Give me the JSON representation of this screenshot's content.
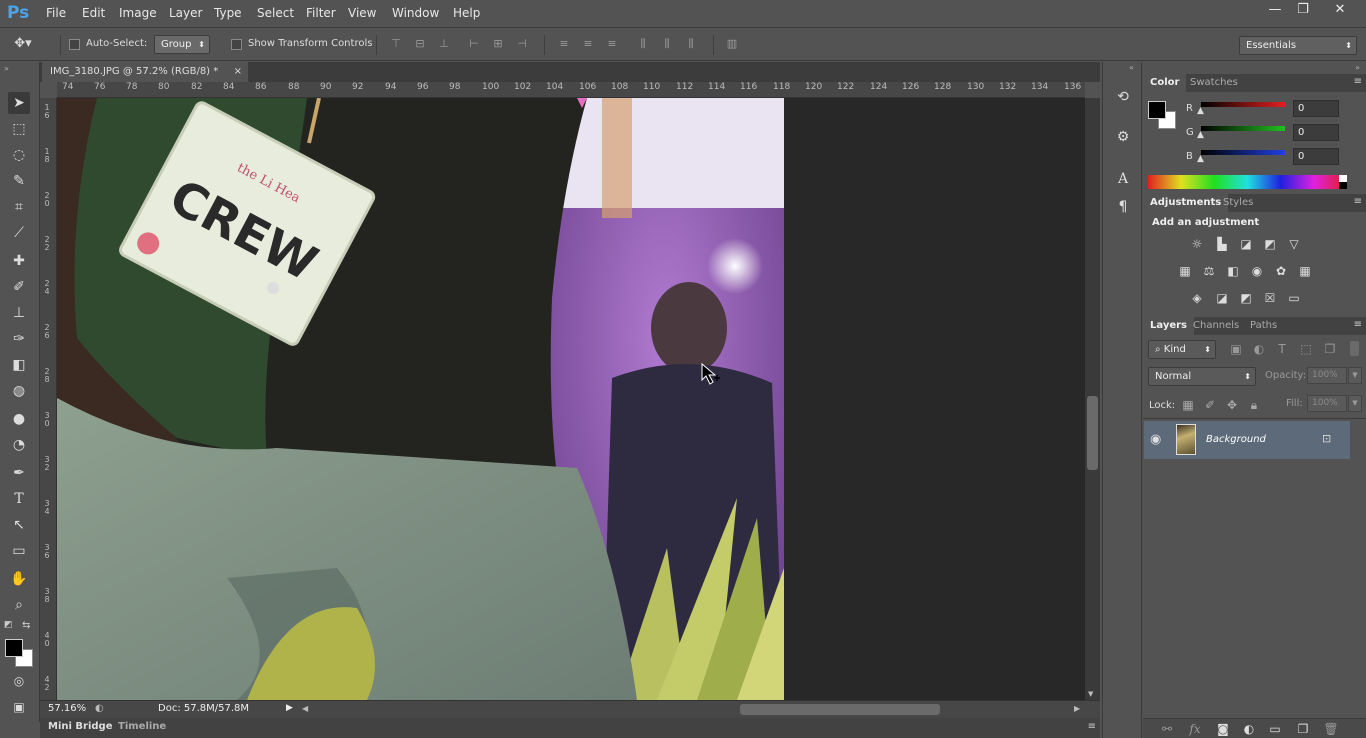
{
  "app": {
    "logo": "Ps"
  },
  "menu": [
    "File",
    "Edit",
    "Image",
    "Layer",
    "Type",
    "Select",
    "Filter",
    "View",
    "Window",
    "Help"
  ],
  "window_controls": {
    "minimize": "—",
    "restore": "❐",
    "close": "✕"
  },
  "options": {
    "auto_select_label": "Auto-Select:",
    "auto_select_value": "Group",
    "transform_label": "Show Transform Controls",
    "workspace": "Essentials"
  },
  "document": {
    "tab_title": "IMG_3180.JPG @ 57.2% (RGB/8) *",
    "close": "×"
  },
  "ruler_top": [
    "74",
    "76",
    "78",
    "80",
    "82",
    "84",
    "86",
    "88",
    "90",
    "92",
    "94",
    "96",
    "98",
    "100",
    "102",
    "104",
    "106",
    "108",
    "110",
    "112",
    "114",
    "116",
    "118",
    "120",
    "122",
    "124",
    "126",
    "128",
    "130",
    "132",
    "134",
    "136"
  ],
  "ruler_left": [
    "1\n6",
    "1\n8",
    "2\n0",
    "2\n2",
    "2\n4",
    "2\n6",
    "2\n8",
    "3\n0",
    "3\n2",
    "3\n4",
    "3\n6",
    "3\n8",
    "4\n0",
    "4\n2"
  ],
  "photo_text": {
    "tag_brand": "the Li Hea",
    "tag_word": "CREW"
  },
  "status": {
    "zoom": "57.16%",
    "doc": "Doc: 57.8M/57.8M"
  },
  "bottom_tabs": [
    "Mini Bridge",
    "Timeline"
  ],
  "color_panel": {
    "tabs": [
      "Color",
      "Swatches"
    ],
    "channels": [
      {
        "label": "R",
        "value": "0",
        "color": "#e02020"
      },
      {
        "label": "G",
        "value": "0",
        "color": "#20c020"
      },
      {
        "label": "B",
        "value": "0",
        "color": "#2040e0"
      }
    ]
  },
  "adjustments_panel": {
    "tabs": [
      "Adjustments",
      "Styles"
    ],
    "heading": "Add an adjustment"
  },
  "layers_panel": {
    "tabs": [
      "Layers",
      "Channels",
      "Paths"
    ],
    "filter_kind": "Kind",
    "blend_mode": "Normal",
    "opacity_label": "Opacity:",
    "opacity_value": "100%",
    "lock_label": "Lock:",
    "fill_label": "Fill:",
    "fill_value": "100%",
    "layer_name": "Background"
  }
}
